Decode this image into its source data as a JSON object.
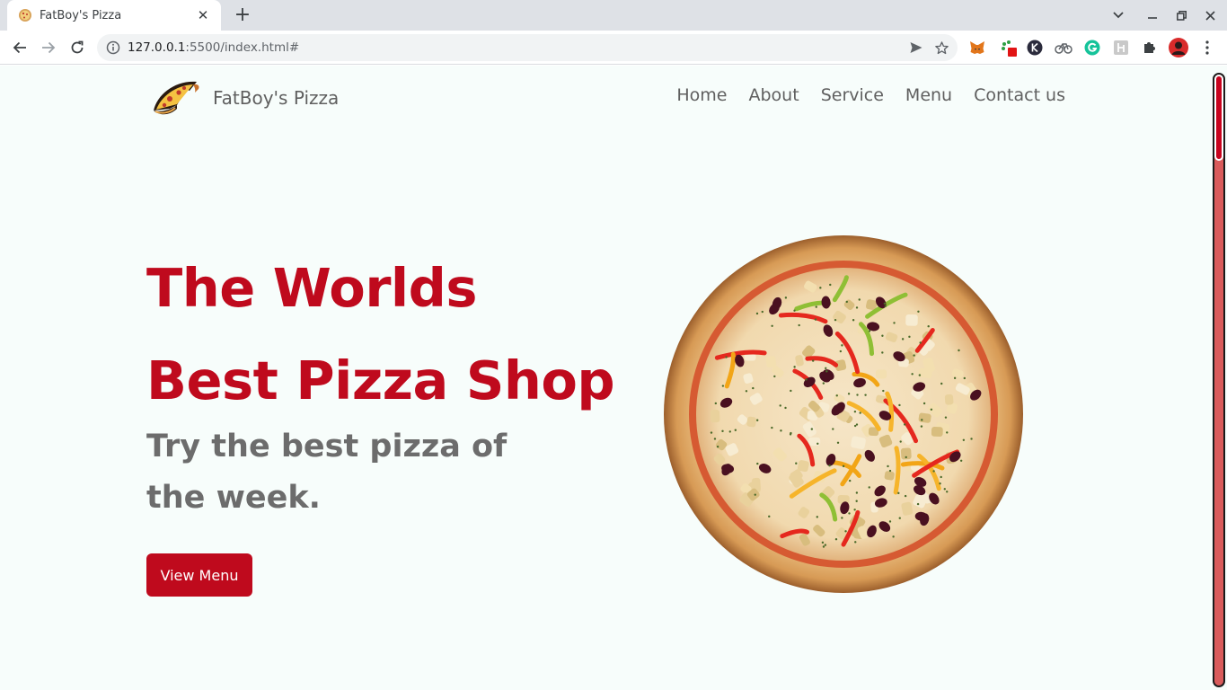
{
  "browser": {
    "tab_title": "FatBoy's Pizza",
    "url_host": "127.0.0.1",
    "url_rest": ":5500/index.html#",
    "tab_close_glyph": "✕",
    "new_tab_glyph": "+"
  },
  "site": {
    "brand_name": "FatBoy's Pizza",
    "nav": [
      "Home",
      "About",
      "Service",
      "Menu",
      "Contact us"
    ]
  },
  "hero": {
    "title_line1": "The Worlds",
    "title_line2": "Best Pizza Shop",
    "subtitle": "Try the best pizza of the week.",
    "cta_label": "View Menu"
  },
  "colors": {
    "accent": "#bf0a1d",
    "page_bg": "#f7fdfb",
    "muted_text": "#6c6c6c"
  },
  "icons": [
    "pizza-favicon",
    "back-icon",
    "forward-icon",
    "reload-icon",
    "info-icon",
    "send-icon",
    "star-icon",
    "metamask-icon",
    "extension-paw-icon",
    "extension-k-icon",
    "extension-bike-icon",
    "grammarly-icon",
    "extension-h-icon",
    "puzzle-icon",
    "profile-avatar",
    "menu-kebab-icon",
    "pizza-slice-logo"
  ]
}
